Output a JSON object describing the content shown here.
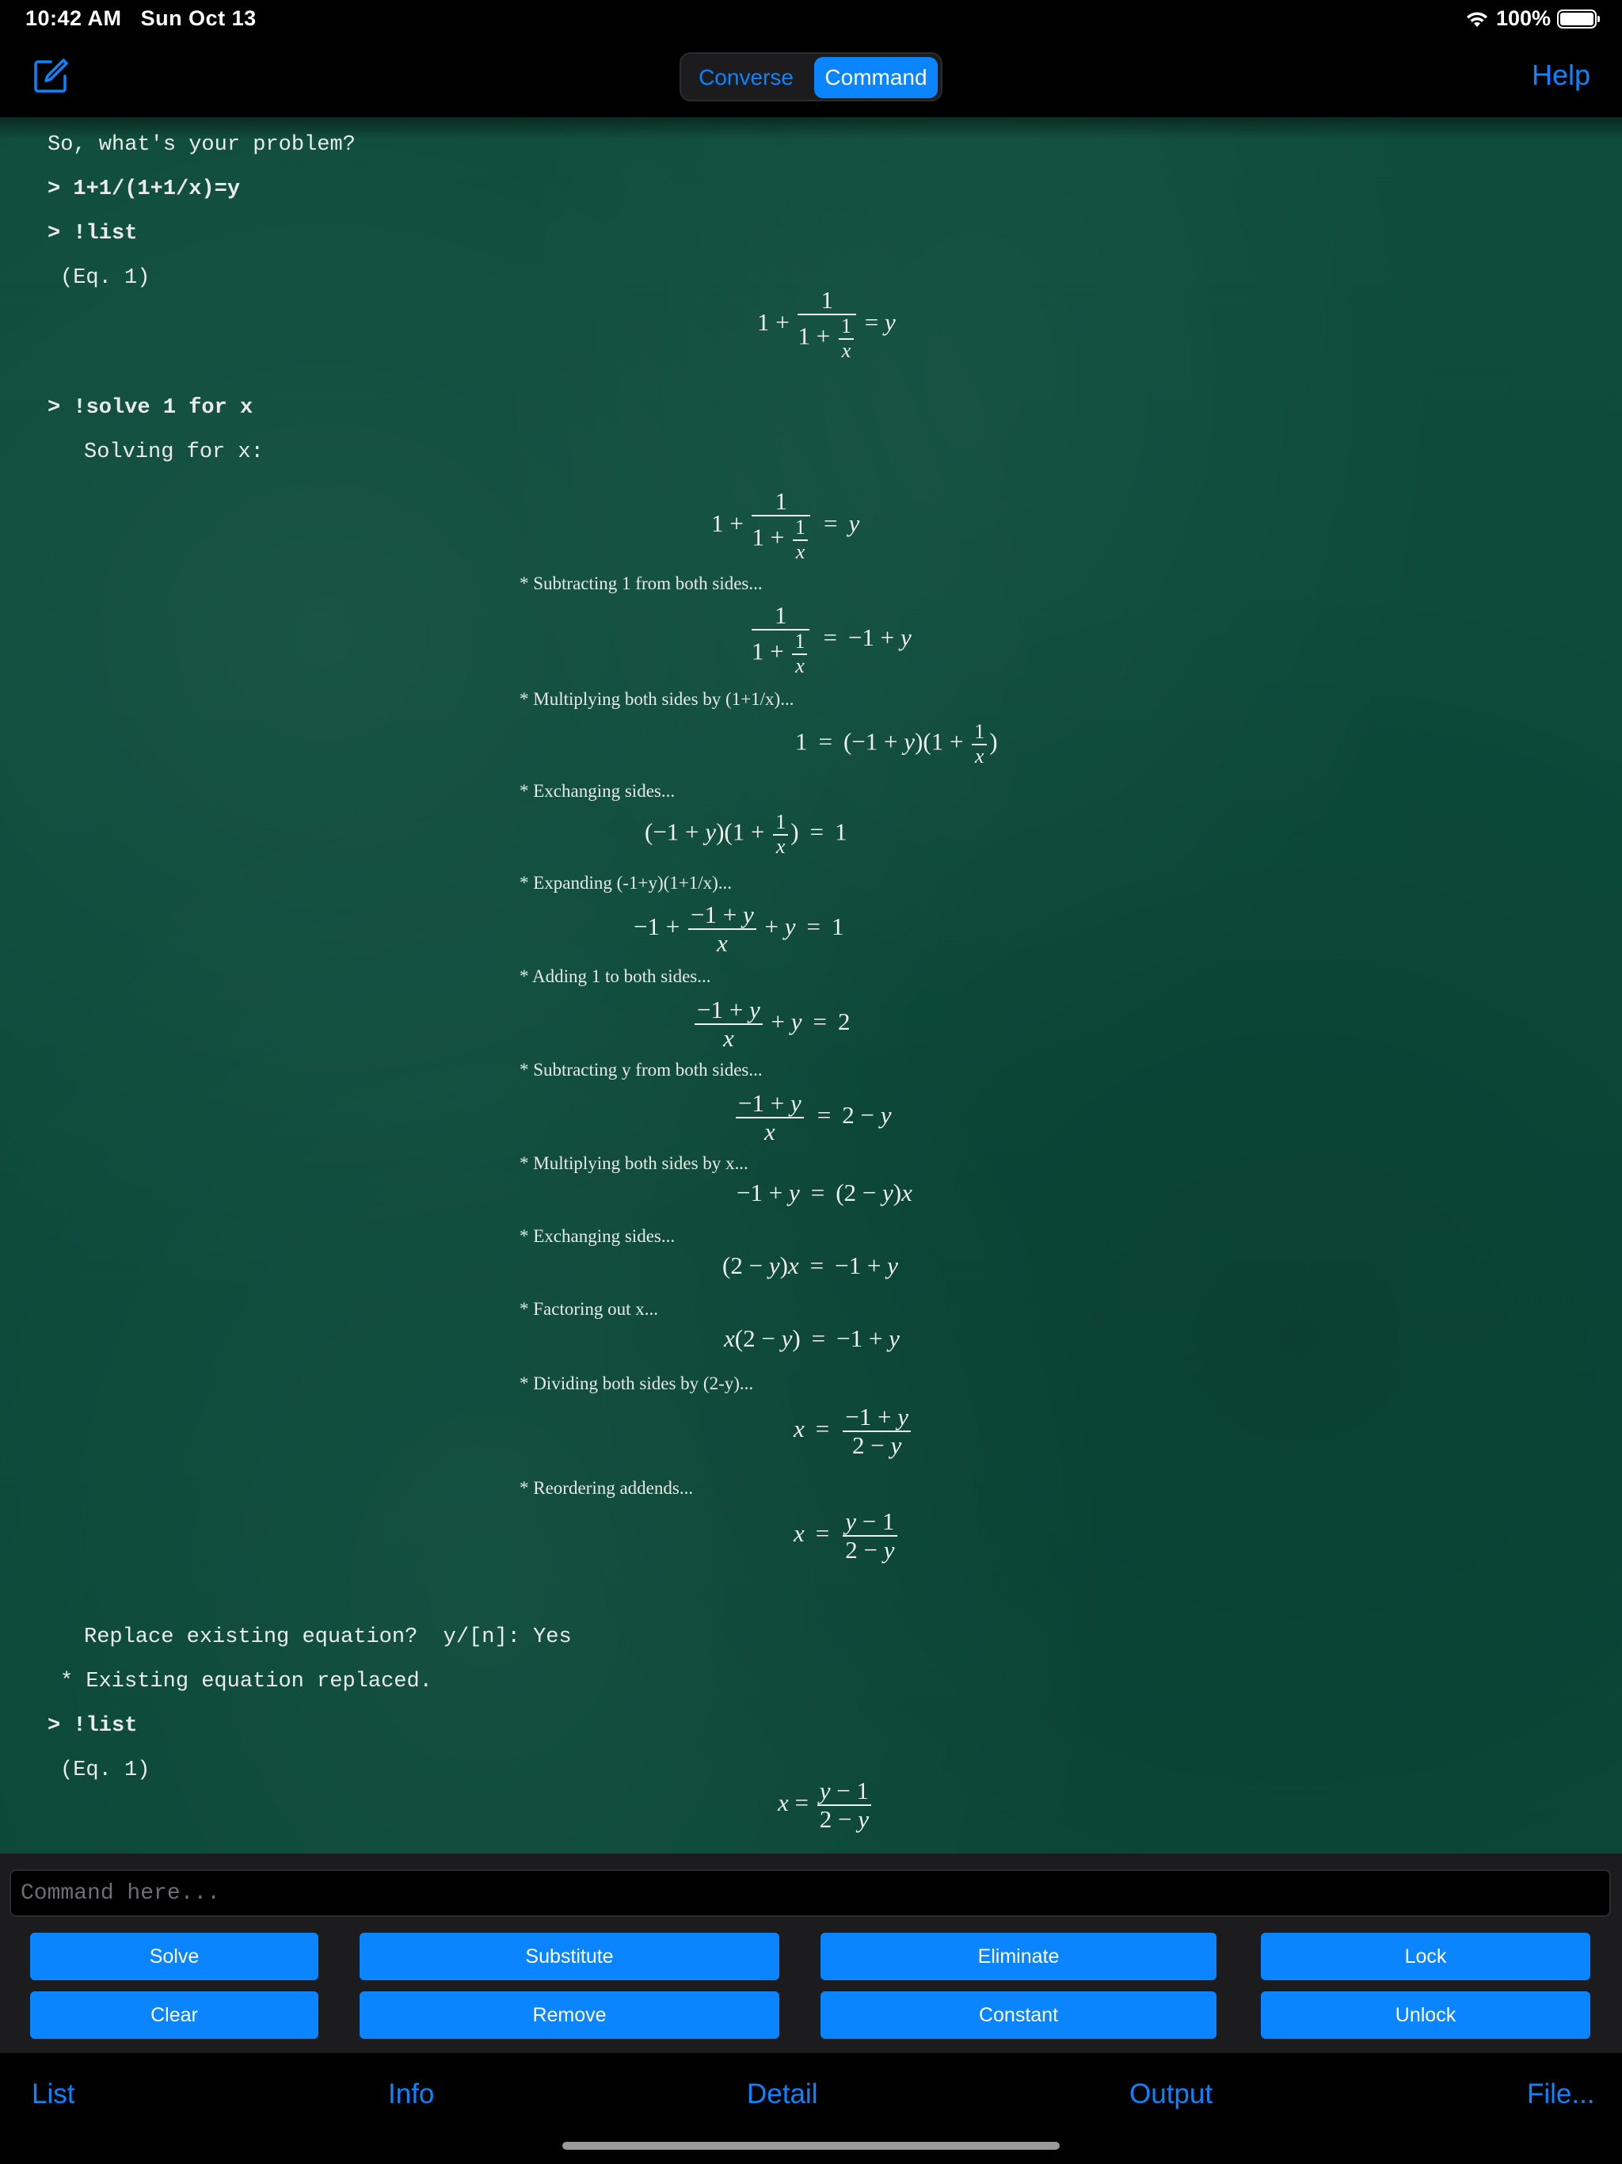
{
  "status": {
    "time": "10:42 AM",
    "date": "Sun Oct 13",
    "battery": "100%",
    "battery_level": 1.0
  },
  "nav": {
    "segments": [
      "Converse",
      "Command"
    ],
    "selected_segment": "Command",
    "help": "Help"
  },
  "console": {
    "greeting": "So, what's your problem?",
    "cmd1": "> 1+1/(1+1/x)=y",
    "cmd2": "> !list",
    "eq_label1": "(Eq. 1)",
    "cmd3": "> !solve 1 for x",
    "solving": "Solving for x:",
    "steps": [
      "* Subtracting 1 from both sides...",
      "* Multiplying both sides by (1+1/x)...",
      "* Exchanging sides...",
      "* Expanding (-1+y)(1+1/x)...",
      "* Adding 1 to both sides...",
      "* Subtracting y from both sides...",
      "* Multiplying both sides by x...",
      "* Exchanging sides...",
      "* Factoring out x...",
      "* Dividing both sides by (2-y)...",
      "* Reordering addends..."
    ],
    "replace_prompt": "Replace existing equation?  y/[n]: Yes",
    "replaced": "* Existing equation replaced.",
    "cmd4": "> !list",
    "eq_label2": "(Eq. 1)"
  },
  "input": {
    "placeholder": "Command here..."
  },
  "buttons": {
    "solve": "Solve",
    "substitute": "Substitute",
    "eliminate": "Eliminate",
    "lock": "Lock",
    "clear": "Clear",
    "remove": "Remove",
    "constant": "Constant",
    "unlock": "Unlock"
  },
  "tabs": {
    "list": "List",
    "info": "Info",
    "detail": "Detail",
    "output": "Output",
    "file": "File..."
  },
  "colors": {
    "accent": "#0a84ff",
    "board": "#0c4a3a"
  }
}
